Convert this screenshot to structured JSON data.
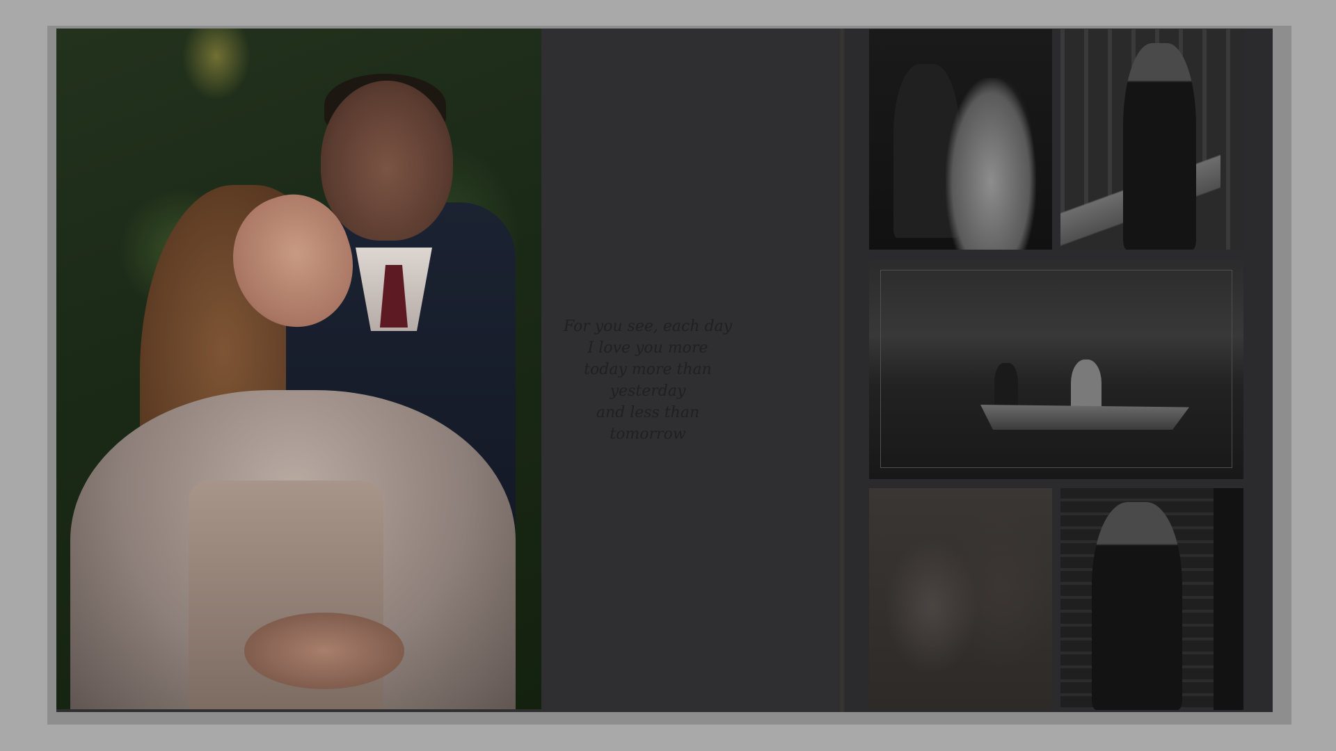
{
  "album": {
    "verse_lines": [
      "For you see, each day",
      "I love you more",
      "today more than",
      "yesterday",
      "and less than",
      "tomorrow"
    ]
  },
  "colors": {
    "page_background": "#a9a9a9",
    "spread_background": "#2f2f31"
  }
}
